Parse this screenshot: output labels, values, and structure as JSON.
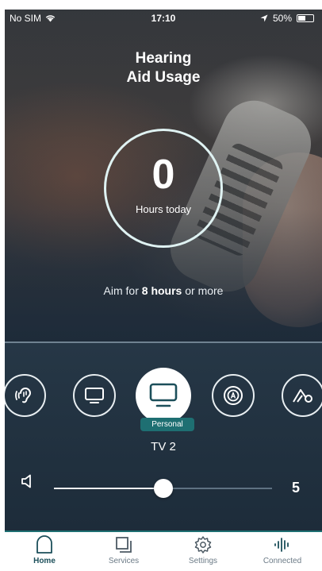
{
  "status_bar": {
    "carrier": "No SIM",
    "time": "17:10",
    "battery_text": "50%",
    "battery_level": 0.5
  },
  "usage": {
    "title_line1": "Hearing",
    "title_line2": "Aid Usage",
    "hours_value": "0",
    "hours_label": "Hours today",
    "aim_prefix": "Aim for",
    "aim_bold": "8 hours",
    "aim_suffix": "or more"
  },
  "programs": {
    "items": [
      {
        "icon": "ear-icon",
        "selected": false
      },
      {
        "icon": "tv-icon",
        "selected": false
      },
      {
        "icon": "tv-icon",
        "selected": true
      },
      {
        "icon": "auto-program-icon",
        "selected": false
      },
      {
        "icon": "mountain-icon",
        "selected": false
      }
    ],
    "active_badge": "Personal",
    "active_name": "TV 2"
  },
  "volume": {
    "value": "5",
    "level_fraction": 0.5
  },
  "tabs": [
    {
      "label": "Home",
      "icon": "home-icon",
      "active": true
    },
    {
      "label": "Services",
      "icon": "services-icon",
      "active": false
    },
    {
      "label": "Settings",
      "icon": "settings-icon",
      "active": false
    },
    {
      "label": "Connected",
      "icon": "connected-icon",
      "active": false
    }
  ],
  "colors": {
    "accent": "#1e6f72",
    "tab_active": "#1c4f5a",
    "tab_inactive": "#6b7a86"
  }
}
